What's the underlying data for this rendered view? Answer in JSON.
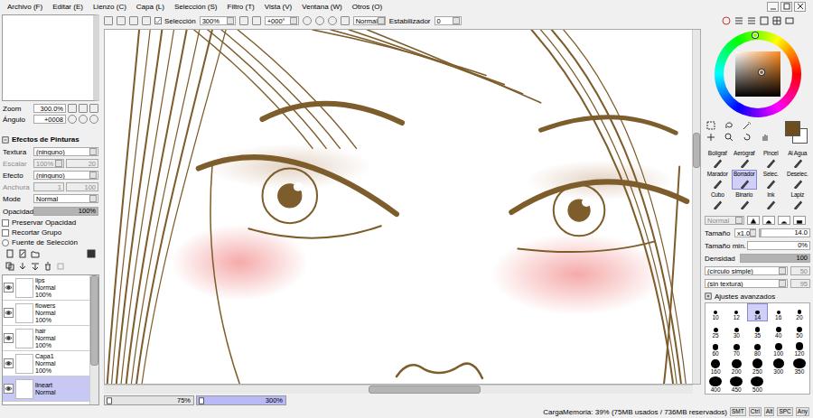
{
  "menu": [
    "Archivo (F)",
    "Editar (E)",
    "Lienzo (C)",
    "Capa (L)",
    "Selección (S)",
    "Filtro (T)",
    "Vista (V)",
    "Ventana (W)",
    "Otros (O)"
  ],
  "toolbar": {
    "selection": {
      "label": "Selección",
      "checked": true
    },
    "zoom": "300%",
    "angle": "+000°",
    "blend": "Normal",
    "stabilizer_label": "Estabilizador",
    "stabilizer": "0"
  },
  "navigator": {
    "zoom_label": "Zoom",
    "zoom": "300.0%",
    "angle_label": "Ángulo",
    "angle": "+0008"
  },
  "paint_effects": {
    "title": "Efectos de Pinturas",
    "texture_label": "Textura",
    "texture": "(ninguno)",
    "scale_label": "Escalar",
    "scale": "100%",
    "scale_value": "20",
    "effect_label": "Efecto",
    "effect": "(ninguno)",
    "width_label": "Anchura",
    "width": "1",
    "width_value": "100"
  },
  "mode": {
    "label": "Mode",
    "value": "Normal"
  },
  "opacity": {
    "label": "Opacidad",
    "value": "100%",
    "level": 1
  },
  "options": [
    {
      "label": "Preservar Opacidad",
      "checked": false,
      "kind": "checkbox"
    },
    {
      "label": "Recortar Grupo",
      "checked": false,
      "kind": "checkbox"
    },
    {
      "label": "Fuente de Selección",
      "checked": false,
      "kind": "radio"
    }
  ],
  "layers": [
    {
      "name": "lips",
      "mode": "Normal",
      "opacity": "100%",
      "visible": true,
      "selected": false
    },
    {
      "name": "flowers",
      "mode": "Normal",
      "opacity": "100%",
      "visible": true,
      "selected": false
    },
    {
      "name": "hair",
      "mode": "Normal",
      "opacity": "100%",
      "visible": true,
      "selected": false
    },
    {
      "name": "Capa1",
      "mode": "Normal",
      "opacity": "100%",
      "visible": true,
      "selected": false
    },
    {
      "name": "lineart",
      "mode": "Normal",
      "visible": true,
      "selected": true
    }
  ],
  "canvas_scroll": {
    "v_start": 0.29,
    "v_size": 0.1,
    "h_start": 0.45,
    "h_size": 0.19
  },
  "canvas_tabs": [
    {
      "label": "75%",
      "selected": false
    },
    {
      "label": "300%",
      "selected": true
    }
  ],
  "status": {
    "memory": "CargaMemoria: 39% (75MB usados / 736MB reservados)",
    "keys": [
      "SMT",
      "Ctrl",
      "Alt",
      "SPC",
      "Any"
    ]
  },
  "color": {
    "foreground": "#6e4e1e",
    "background": "#ffffff"
  },
  "tools": [
    {
      "label": "Bolígraf",
      "selected": false
    },
    {
      "label": "Aerógraf",
      "selected": false
    },
    {
      "label": "Pincel",
      "selected": false
    },
    {
      "label": "Al Agua",
      "selected": false
    },
    {
      "label": "Marador",
      "selected": false
    },
    {
      "label": "Borrador",
      "selected": true
    },
    {
      "label": "Selec.",
      "selected": false
    },
    {
      "label": "Deselec.",
      "selected": false
    },
    {
      "label": "Cubo",
      "selected": false
    },
    {
      "label": "Binario",
      "selected": false
    },
    {
      "label": "Ink",
      "selected": false
    },
    {
      "label": "Lapiz",
      "selected": false
    }
  ],
  "brush": {
    "blend": "Normal",
    "size_label": "Tamaño",
    "size_mult": "x1.0",
    "size": "14.0",
    "size_level": 0.03,
    "min_label": "Tamaño min.",
    "min": "0%",
    "min_level": 0,
    "density_label": "Densidad",
    "density": "100",
    "density_level": 1,
    "shape": "(círculo simple)",
    "shape_value": "50",
    "texture": "(sin textura)",
    "texture_value": "95",
    "advanced": "Ajustes avanzados"
  },
  "brush_sizes": [
    {
      "label": "10",
      "selected": false
    },
    {
      "label": "12",
      "selected": false
    },
    {
      "label": "14",
      "selected": true
    },
    {
      "label": "16",
      "selected": false
    },
    {
      "label": "20",
      "selected": false
    },
    {
      "label": "25",
      "selected": false
    },
    {
      "label": "30",
      "selected": false
    },
    {
      "label": "35",
      "selected": false
    },
    {
      "label": "40",
      "selected": false
    },
    {
      "label": "50",
      "selected": false
    },
    {
      "label": "60",
      "selected": false
    },
    {
      "label": "70",
      "selected": false
    },
    {
      "label": "80",
      "selected": false
    },
    {
      "label": "100",
      "selected": false
    },
    {
      "label": "120",
      "selected": false
    },
    {
      "label": "160",
      "selected": false
    },
    {
      "label": "200",
      "selected": false
    },
    {
      "label": "250",
      "selected": false
    },
    {
      "label": "300",
      "selected": false
    },
    {
      "label": "350",
      "selected": false
    },
    {
      "label": "400",
      "selected": false
    },
    {
      "label": "450",
      "selected": false
    },
    {
      "label": "500",
      "selected": false
    }
  ]
}
